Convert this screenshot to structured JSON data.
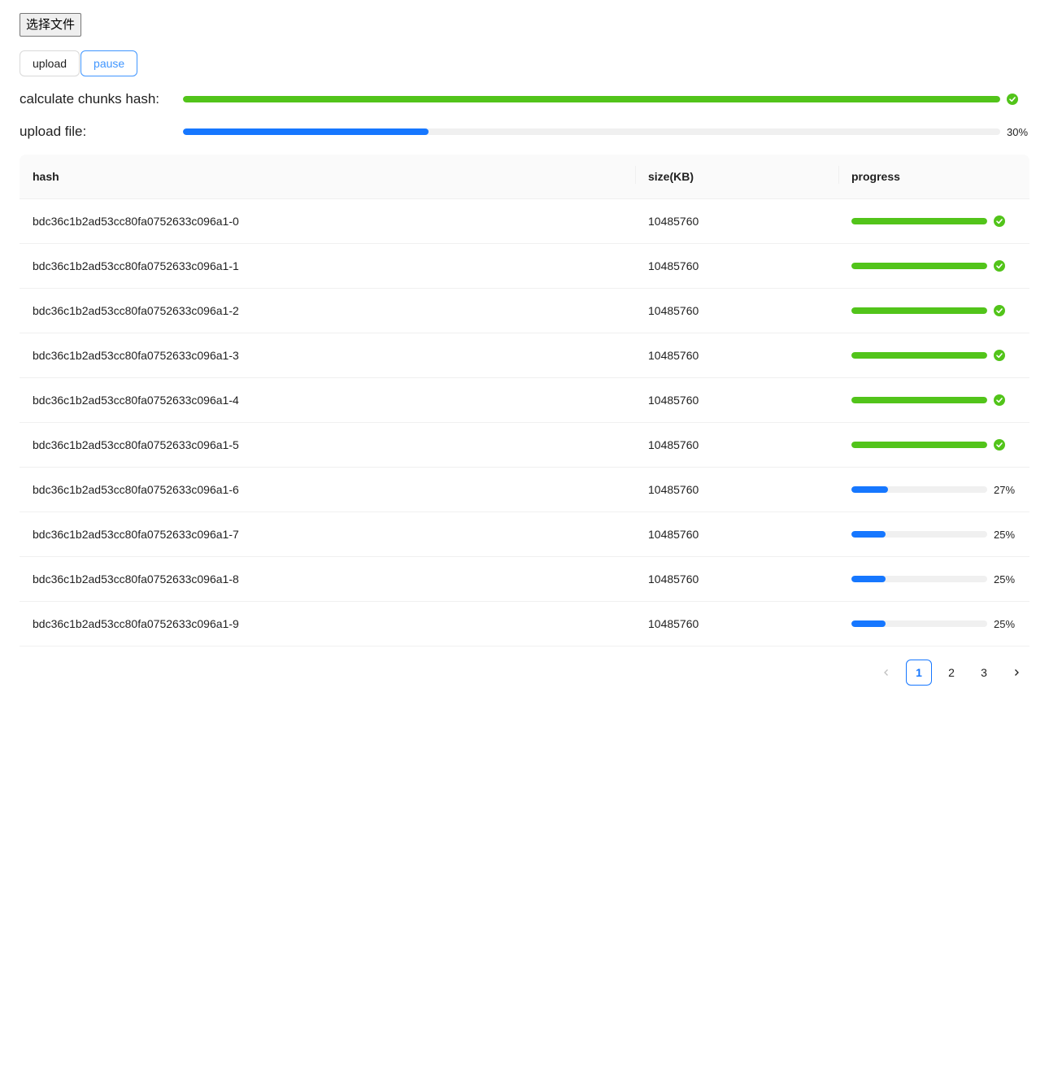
{
  "file_input": {
    "label": "选择文件"
  },
  "actions": {
    "upload_label": "upload",
    "pause_label": "pause"
  },
  "hash_progress": {
    "label": "calculate chunks hash:",
    "percent": 100,
    "status": "success"
  },
  "upload_progress": {
    "label": "upload file:",
    "percent": 30,
    "percent_text": "30%",
    "status": "active"
  },
  "table": {
    "columns": [
      "hash",
      "size(KB)",
      "progress"
    ],
    "rows": [
      {
        "hash": "bdc36c1b2ad53cc80fa0752633c096a1-0",
        "size": "10485760",
        "percent": 100,
        "percent_text": "",
        "status": "success"
      },
      {
        "hash": "bdc36c1b2ad53cc80fa0752633c096a1-1",
        "size": "10485760",
        "percent": 100,
        "percent_text": "",
        "status": "success"
      },
      {
        "hash": "bdc36c1b2ad53cc80fa0752633c096a1-2",
        "size": "10485760",
        "percent": 100,
        "percent_text": "",
        "status": "success"
      },
      {
        "hash": "bdc36c1b2ad53cc80fa0752633c096a1-3",
        "size": "10485760",
        "percent": 100,
        "percent_text": "",
        "status": "success"
      },
      {
        "hash": "bdc36c1b2ad53cc80fa0752633c096a1-4",
        "size": "10485760",
        "percent": 100,
        "percent_text": "",
        "status": "success"
      },
      {
        "hash": "bdc36c1b2ad53cc80fa0752633c096a1-5",
        "size": "10485760",
        "percent": 100,
        "percent_text": "",
        "status": "success"
      },
      {
        "hash": "bdc36c1b2ad53cc80fa0752633c096a1-6",
        "size": "10485760",
        "percent": 27,
        "percent_text": "27%",
        "status": "active"
      },
      {
        "hash": "bdc36c1b2ad53cc80fa0752633c096a1-7",
        "size": "10485760",
        "percent": 25,
        "percent_text": "25%",
        "status": "active"
      },
      {
        "hash": "bdc36c1b2ad53cc80fa0752633c096a1-8",
        "size": "10485760",
        "percent": 25,
        "percent_text": "25%",
        "status": "active"
      },
      {
        "hash": "bdc36c1b2ad53cc80fa0752633c096a1-9",
        "size": "10485760",
        "percent": 25,
        "percent_text": "25%",
        "status": "active"
      }
    ]
  },
  "pagination": {
    "pages": [
      "1",
      "2",
      "3"
    ],
    "current": "1",
    "prev_icon": "chevron-left-icon",
    "next_icon": "chevron-right-icon"
  },
  "colors": {
    "success": "#52c41a",
    "active": "#1677ff",
    "track": "#f0f0f0",
    "pause_accent": "#4096ff"
  }
}
